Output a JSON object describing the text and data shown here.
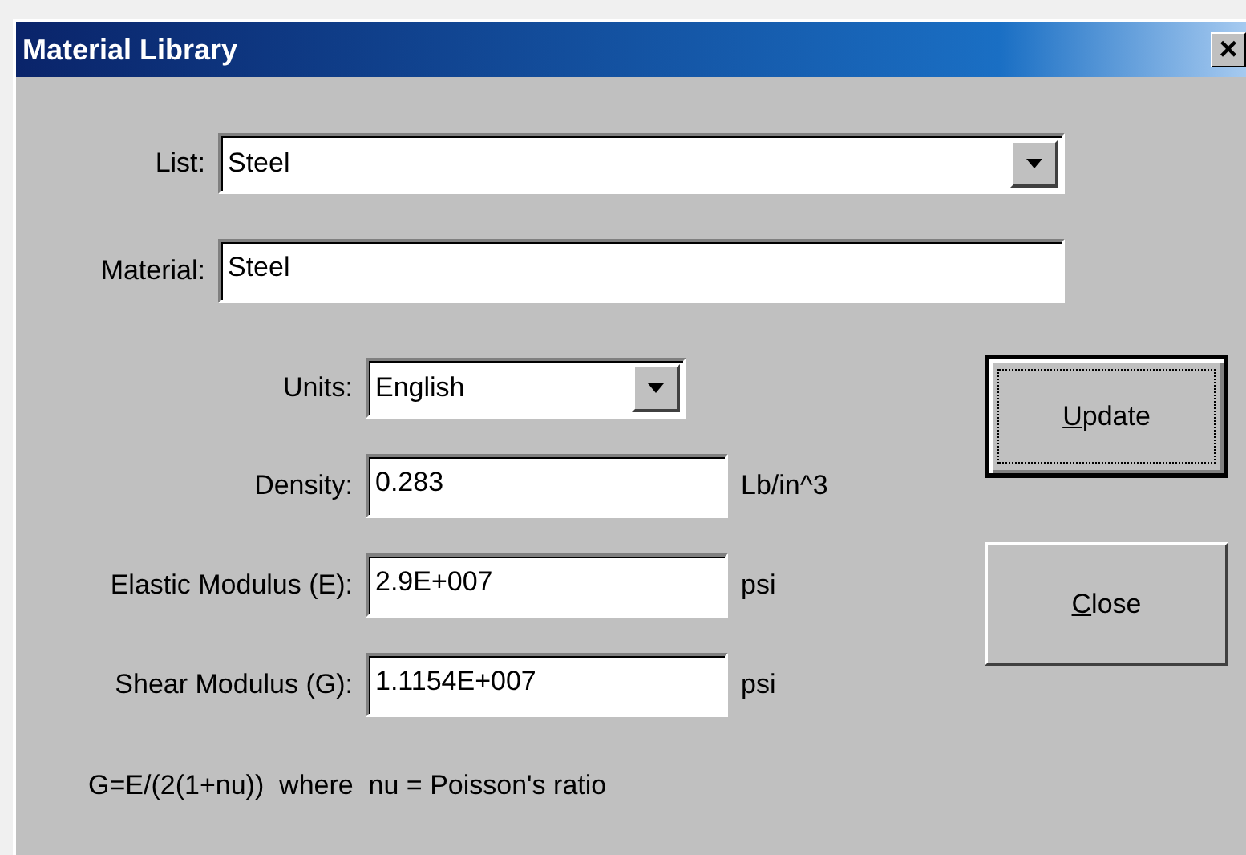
{
  "window": {
    "title": "Material Library",
    "close_glyph": "×"
  },
  "top_fields": [
    {
      "label": "List:",
      "kind": "combo",
      "value": "Steel"
    },
    {
      "label": "Material:",
      "kind": "text",
      "value": "Steel"
    }
  ],
  "property_fields": [
    {
      "label": "Units:",
      "kind": "combo",
      "value": "English"
    },
    {
      "label": "Density:",
      "kind": "text",
      "value": "0.283",
      "unit": "Lb/in^3"
    },
    {
      "label": "Elastic Modulus (E):",
      "kind": "text",
      "value": "2.9E+007",
      "unit": "psi"
    },
    {
      "label": "Shear Modulus (G):",
      "kind": "text",
      "value": "1.1154E+007",
      "unit": "psi"
    }
  ],
  "note": "G=E/(2(1+nu))  where  nu = Poisson's ratio",
  "buttons": [
    {
      "mnemonic": "U",
      "label_rest": "pdate",
      "default": true
    },
    {
      "mnemonic": "C",
      "label_rest": "lose",
      "default": false
    }
  ]
}
